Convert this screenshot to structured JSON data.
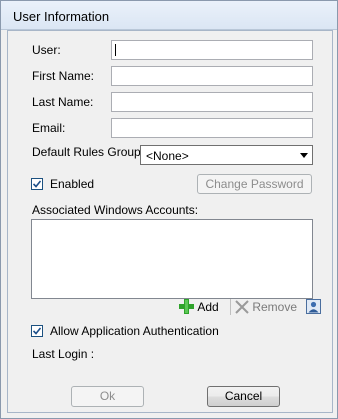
{
  "window": {
    "title": "User Information"
  },
  "form": {
    "user_label": "User:",
    "user_value": "",
    "first_name_label": "First Name:",
    "first_name_value": "",
    "last_name_label": "Last Name:",
    "last_name_value": "",
    "email_label": "Email:",
    "email_value": "",
    "rules_group_label": "Default Rules Group:",
    "rules_group_value": "<None>",
    "enabled_label": "Enabled",
    "enabled_checked": true,
    "change_password_label": "Change Password",
    "windows_accounts_label": "Associated Windows Accounts:",
    "add_label": "Add",
    "remove_label": "Remove",
    "allow_auth_label": "Allow Application Authentication",
    "allow_auth_checked": true,
    "last_login_label": "Last Login :"
  },
  "buttons": {
    "ok_label": "Ok",
    "cancel_label": "Cancel"
  },
  "icons": {
    "add": "plus-icon",
    "remove": "x-icon",
    "browse": "user-picker-icon"
  },
  "colors": {
    "add_icon": "#2fa32b",
    "check": "#1d4f8a"
  }
}
